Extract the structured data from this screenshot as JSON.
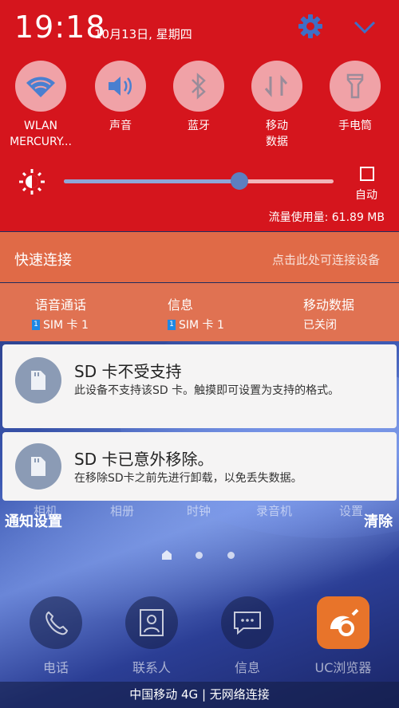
{
  "status": {
    "time": "19:18",
    "date": "10月13日, 星期四"
  },
  "quick_tiles": [
    {
      "label": "WLAN",
      "sublabel": "MERCURY...",
      "icon": "wifi-icon"
    },
    {
      "label": "声音",
      "sublabel": "",
      "icon": "volume-icon"
    },
    {
      "label": "蓝牙",
      "sublabel": "",
      "icon": "bluetooth-icon"
    },
    {
      "label": "移动",
      "sublabel": "数据",
      "icon": "mobile-data-icon"
    },
    {
      "label": "手电筒",
      "sublabel": "",
      "icon": "flashlight-icon"
    }
  ],
  "brightness": {
    "level": 0.65,
    "auto_label": "自动"
  },
  "data_usage": "流量使用量: 61.89 MB",
  "quick_connect": {
    "title": "快速连接",
    "hint": "点击此处可连接设备"
  },
  "sim_info": [
    {
      "title": "语音通话",
      "badge": "1",
      "value": "SIM 卡 1"
    },
    {
      "title": "信息",
      "badge": "1",
      "value": "SIM 卡 1"
    },
    {
      "title": "移动数据",
      "badge": "",
      "value": "已关闭"
    }
  ],
  "notifications": [
    {
      "title": "SD 卡不受支持",
      "body": "此设备不支持该SD 卡。触摸即可设置为支持的格式。",
      "icon": "sd-card-icon"
    },
    {
      "title": "SD 卡已意外移除。",
      "body": "在移除SD卡之前先进行卸载，以免丢失数据。",
      "icon": "sd-card-icon"
    }
  ],
  "actions": {
    "notification_settings": "通知设置",
    "clear": "清除"
  },
  "home_screen": {
    "app_row_labels": [
      "相机",
      "相册",
      "时钟",
      "录音机",
      "设置"
    ],
    "dock": [
      {
        "label": "电话",
        "icon": "phone-icon"
      },
      {
        "label": "联系人",
        "icon": "contacts-icon"
      },
      {
        "label": "信息",
        "icon": "messages-icon"
      },
      {
        "label": "UC浏览器",
        "icon": "uc-browser-icon"
      }
    ],
    "carrier_status": "中国移动 4G | 无网络连接"
  },
  "colors": {
    "panel_red": "#d5151d",
    "quick_connect": "#e06a47",
    "tile_circle": "#f0a2a7",
    "slider_thumb": "#5d7fc0"
  }
}
